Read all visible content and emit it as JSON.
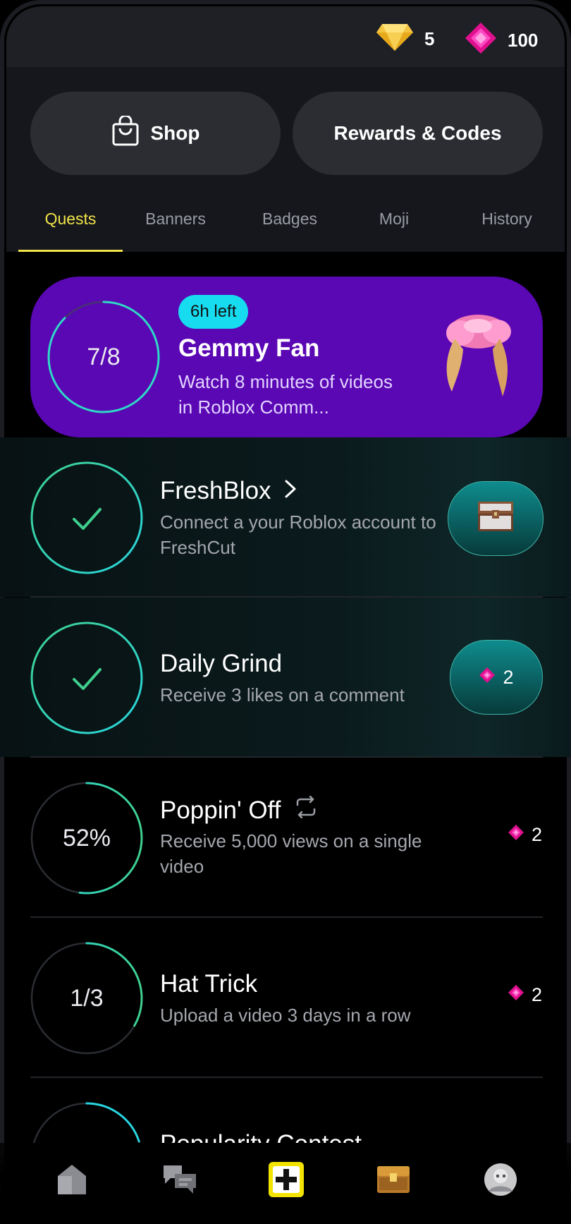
{
  "currency": {
    "gold": {
      "icon": "gold-diamond-icon",
      "value": "5"
    },
    "gems": {
      "icon": "pink-gem-icon",
      "value": "100"
    }
  },
  "header": {
    "shop_label": "Shop",
    "rewards_label": "Rewards & Codes"
  },
  "tabs": [
    {
      "label": "Quests",
      "active": true
    },
    {
      "label": "Banners",
      "active": false
    },
    {
      "label": "Badges",
      "active": false
    },
    {
      "label": "Moji",
      "active": false
    },
    {
      "label": "History",
      "active": false
    }
  ],
  "featured_quest": {
    "progress_text": "7/8",
    "progress_fraction": 0.875,
    "time_left": "6h left",
    "title": "Gemmy Fan",
    "description": "Watch 8 minutes of videos in Roblox Comm...",
    "reward_icon": "pink-pigtails-hair-icon",
    "bg_color": "#5a07b4"
  },
  "quests": [
    {
      "title": "FreshBlox",
      "description": "Connect a your Roblox account to FreshCut",
      "status": "completed",
      "has_chevron": true,
      "reward": {
        "type": "chest",
        "icon": "treasure-chest-icon"
      }
    },
    {
      "title": "Daily Grind",
      "description": "Receive 3 likes on a comment",
      "status": "completed",
      "reward": {
        "type": "gems",
        "amount": "2"
      }
    },
    {
      "title": "Poppin' Off",
      "description": "Receive 5,000 views on a single video",
      "status": "in-progress",
      "progress_text": "52%",
      "progress_fraction": 0.52,
      "repeat_icon": "repeat-icon",
      "reward": {
        "type": "gems",
        "amount": "2"
      }
    },
    {
      "title": "Hat Trick",
      "description": "Upload a video 3 days in a row",
      "status": "in-progress",
      "progress_text": "1/3",
      "progress_fraction": 0.333,
      "reward": {
        "type": "gems",
        "amount": "2"
      }
    },
    {
      "title": "Popularity Contest",
      "status": "in-progress",
      "progress_fraction": 0.2
    }
  ],
  "bottom_nav": [
    {
      "name": "home-icon"
    },
    {
      "name": "chat-icon"
    },
    {
      "name": "create-icon"
    },
    {
      "name": "rewards-chest-icon"
    },
    {
      "name": "profile-avatar-icon"
    }
  ],
  "colors": {
    "accent_yellow": "#f1e34a",
    "teal": "#2fd8c8",
    "green": "#3ecf8e",
    "gem_pink": "#ff2fb1"
  }
}
